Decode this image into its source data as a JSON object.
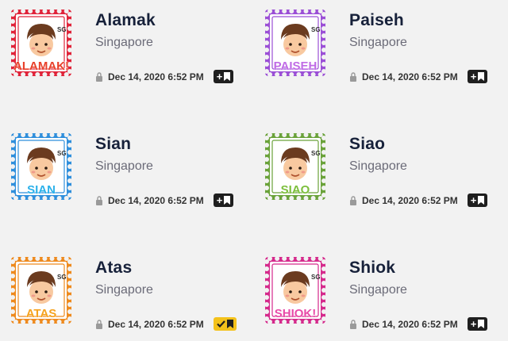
{
  "stickers": [
    {
      "title": "Alamak",
      "subtitle": "Singapore",
      "date": "Dec 14, 2020 6:52 PM",
      "saved": false,
      "stamp_text": "ALAMAK!",
      "stamp_tag": "SG",
      "frame_color": "#e0243a",
      "text_color": "#e8402a",
      "text_outline": "#ffffff"
    },
    {
      "title": "Paiseh",
      "subtitle": "Singapore",
      "date": "Dec 14, 2020 6:52 PM",
      "saved": false,
      "stamp_text": "PAISEH",
      "stamp_tag": "SG",
      "frame_color": "#9b4fd6",
      "text_color": "#c06be6",
      "text_outline": "#ffffff"
    },
    {
      "title": "Sian",
      "subtitle": "Singapore",
      "date": "Dec 14, 2020 6:52 PM",
      "saved": false,
      "stamp_text": "SIAN",
      "stamp_tag": "SG",
      "frame_color": "#2f8fdc",
      "text_color": "#2bb1ea",
      "text_outline": "#ffffff"
    },
    {
      "title": "Siao",
      "subtitle": "Singapore",
      "date": "Dec 14, 2020 6:52 PM",
      "saved": false,
      "stamp_text": "SIAO",
      "stamp_tag": "SG",
      "frame_color": "#6aa23a",
      "text_color": "#7cbf3c",
      "text_outline": "#ffffff"
    },
    {
      "title": "Atas",
      "subtitle": "Singapore",
      "date": "Dec 14, 2020 6:52 PM",
      "saved": true,
      "stamp_text": "ATAS",
      "stamp_tag": "SG",
      "frame_color": "#ee8a1e",
      "text_color": "#f6a21d",
      "text_outline": "#ffffff"
    },
    {
      "title": "Shiok",
      "subtitle": "Singapore",
      "date": "Dec 14, 2020 6:52 PM",
      "saved": false,
      "stamp_text": "SHIOK!",
      "stamp_tag": "SG",
      "frame_color": "#d52a8c",
      "text_color": "#e84aa8",
      "text_outline": "#ffffff"
    }
  ],
  "icons": {
    "lock": "lock-icon",
    "add_bookmark": "add-bookmark-icon",
    "saved": "check-bookmark-icon"
  }
}
